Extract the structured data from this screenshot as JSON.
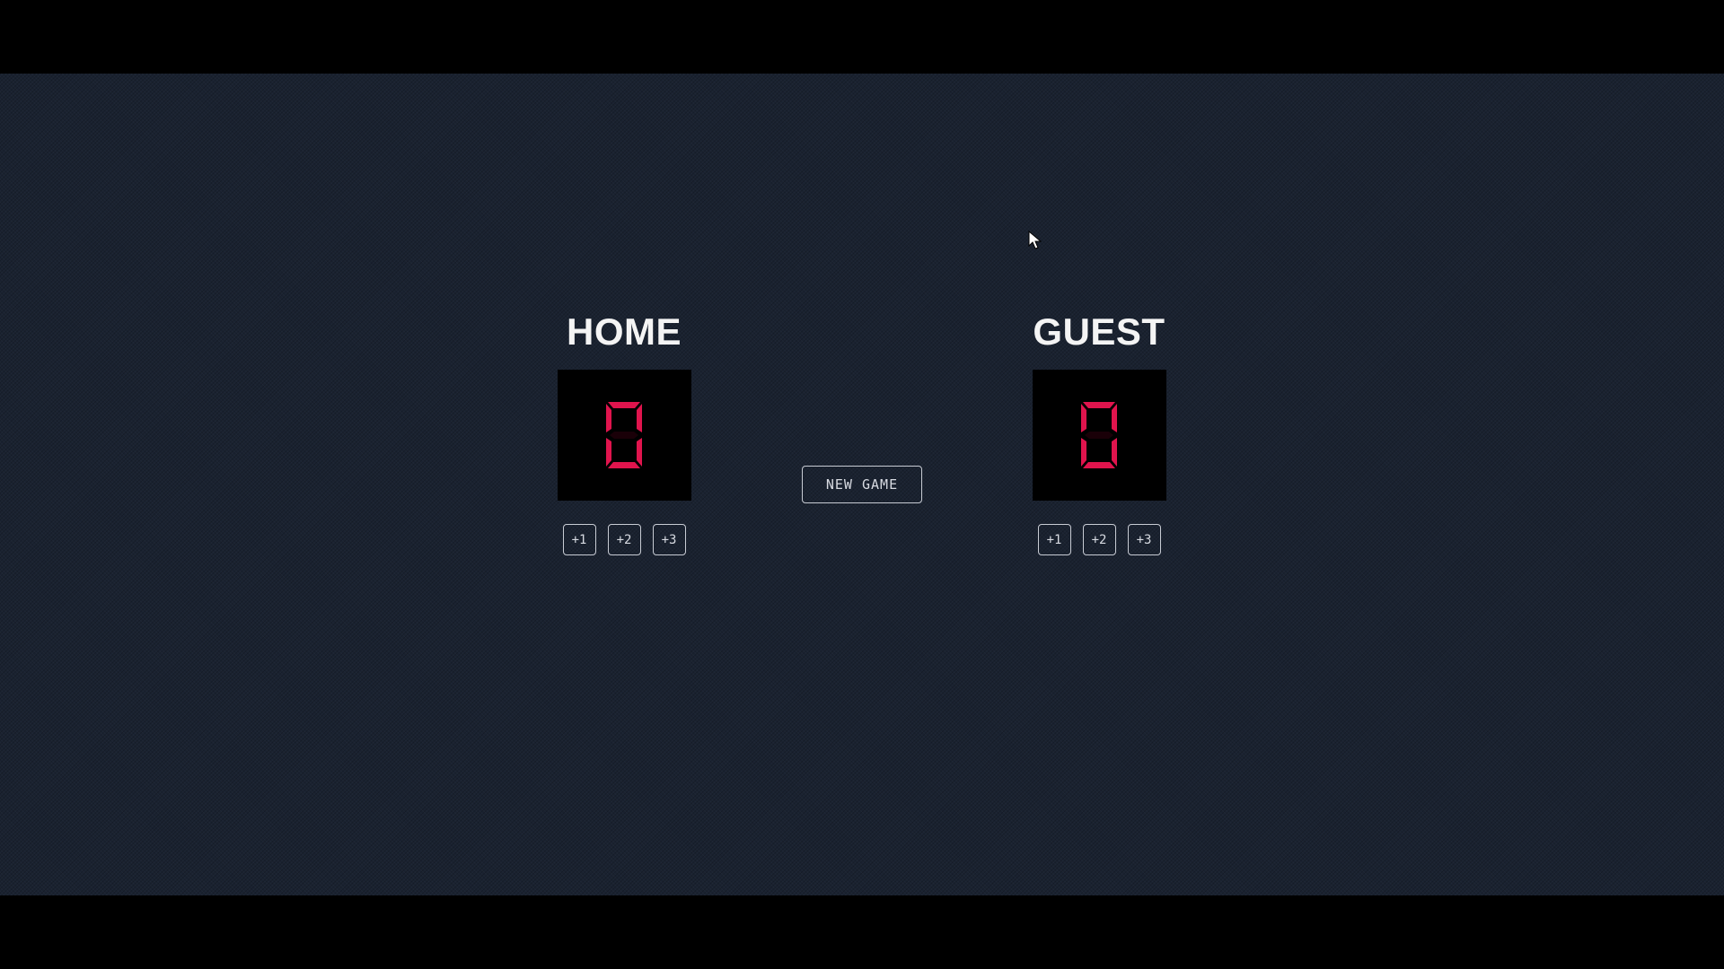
{
  "scoreboard": {
    "home": {
      "title": "HOME",
      "score": "0",
      "buttons": [
        "+1",
        "+2",
        "+3"
      ]
    },
    "guest": {
      "title": "GUEST",
      "score": "0",
      "buttons": [
        "+1",
        "+2",
        "+3"
      ]
    },
    "new_game_label": "NEW GAME"
  },
  "colors": {
    "background": "#1a2230",
    "score_digit": "#e0144d",
    "score_box": "#000000",
    "text": "#f4f4f4",
    "button_border": "#c8ccd4"
  },
  "icons": {
    "cursor": "mouse-pointer-icon"
  }
}
